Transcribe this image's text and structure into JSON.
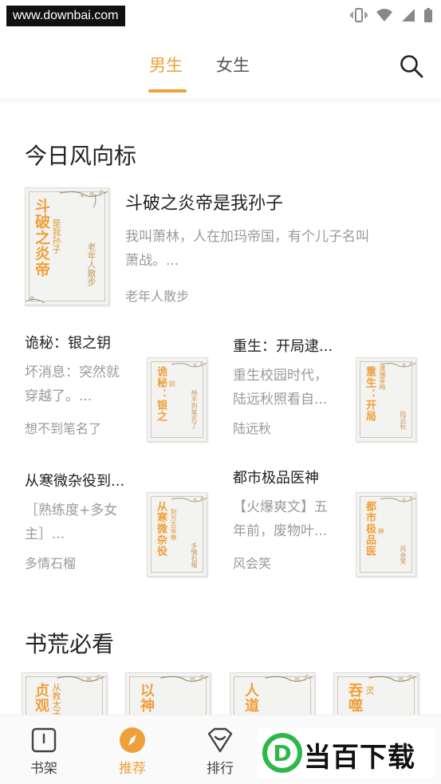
{
  "status_bar": {
    "watermark": "www.downbai.com"
  },
  "header": {
    "tabs": [
      {
        "label": "男生",
        "active": true
      },
      {
        "label": "女生",
        "active": false
      }
    ],
    "accent_color": "#f0a03a"
  },
  "section_today": {
    "title": "今日风向标",
    "featured": {
      "title": "斗破之炎帝是我孙子",
      "desc_line1": "我叫萧林，人在加玛帝国，有个儿子名叫",
      "desc_line2": "萧战。...",
      "author": "老年人散步",
      "cover": {
        "title": "斗破之炎帝",
        "sub": "是我孙子",
        "author": "老年人散步"
      }
    },
    "grid": [
      {
        "title": "诡秘：银之钥",
        "desc_line1": "坏消息：突然就",
        "desc_line2": "穿越了。...",
        "author": "想不到笔名了",
        "cover": {
          "title": "诡秘：银之",
          "sub": "钥",
          "author": "想不到笔名了"
        }
      },
      {
        "title": "重生：开局逮...",
        "desc_line1": "重生校园时代，",
        "desc_line2": "陆远秋照看自...",
        "author": "陆远秋",
        "cover": {
          "title": "重生：开局",
          "sub": "逮捕青梅",
          "author": "陆远秋"
        }
      },
      {
        "title": "从寒微杂役到...",
        "desc_line1": "［熟练度+多女",
        "desc_line2": "主］...",
        "author": "多情石榴",
        "cover": {
          "title": "从寒微杂役",
          "sub": "到万古帝尊",
          "author": "多情石榴"
        }
      },
      {
        "title": "都市极品医神",
        "desc_line1": "【火爆爽文】五",
        "desc_line2": "年前，废物叶...",
        "author": "风会笑",
        "cover": {
          "title": "都市极品医",
          "sub": "神",
          "author": "风会笑"
        }
      }
    ]
  },
  "section_must_read": {
    "title": "书荒必看",
    "covers": [
      {
        "title": "贞观",
        "sub": "从教太子"
      },
      {
        "title": "以神",
        "sub": ""
      },
      {
        "title": "人道",
        "sub": ""
      },
      {
        "title": "吞噬",
        "sub": "灵"
      }
    ]
  },
  "bottom_nav": {
    "items": [
      {
        "label": "书架",
        "icon": "bookshelf-icon",
        "active": false
      },
      {
        "label": "推荐",
        "icon": "compass-icon",
        "active": true
      },
      {
        "label": "排行",
        "icon": "ranking-icon",
        "active": false
      }
    ]
  },
  "watermark_logo": {
    "letter": "D",
    "text": "当百下载"
  }
}
